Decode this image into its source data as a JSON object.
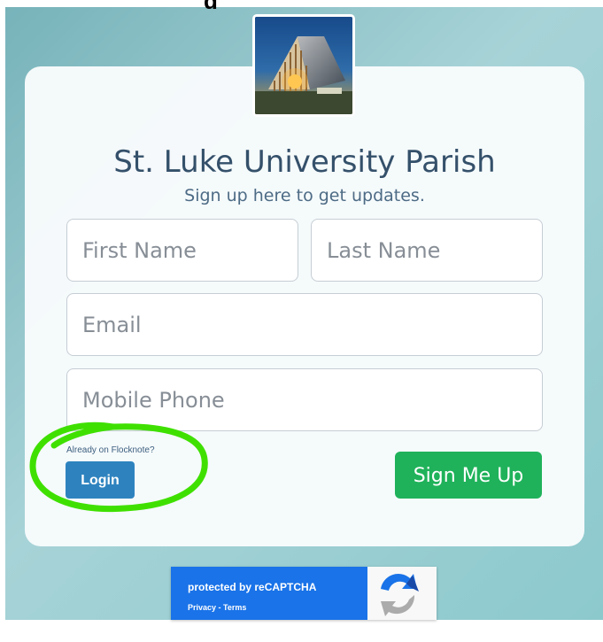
{
  "page": {
    "title_fragment": "g"
  },
  "card": {
    "title": "St. Luke University Parish",
    "subtitle": "Sign up here to get updates."
  },
  "form": {
    "first_name_placeholder": "First Name",
    "last_name_placeholder": "Last Name",
    "email_placeholder": "Email",
    "phone_placeholder": "Mobile Phone",
    "already_text": "Already on Flocknote?",
    "login_label": "Login",
    "signup_label": "Sign Me Up"
  },
  "recaptcha": {
    "protected_text": "protected by reCAPTCHA",
    "privacy_label": "Privacy",
    "separator": " - ",
    "terms_label": "Terms",
    "icon": "recaptcha-logo-icon"
  },
  "colors": {
    "primary_button": "#2e83bf",
    "signup_button": "#1fb25a",
    "highlight": "#3fe000",
    "recaptcha_blue": "#1a73e8"
  }
}
